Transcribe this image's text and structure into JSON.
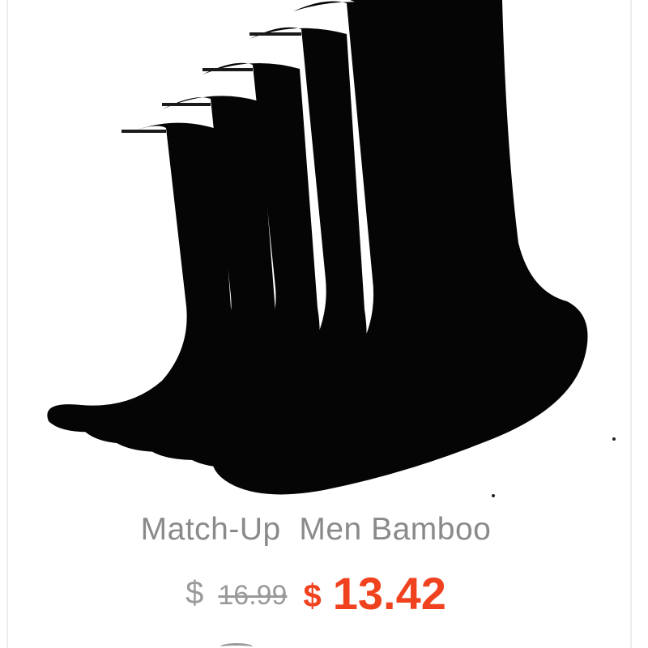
{
  "product": {
    "title": "Match-Up  Men Bamboo",
    "image_icon": "socks-icon",
    "old_price": {
      "currency": "$",
      "value": "16.99"
    },
    "new_price": {
      "currency": "$",
      "value": "13.42"
    }
  },
  "colors": {
    "sale_price": "#f0421f",
    "old_price": "#9a9a9a",
    "title": "#8a8a8a",
    "sock": "#050505"
  }
}
